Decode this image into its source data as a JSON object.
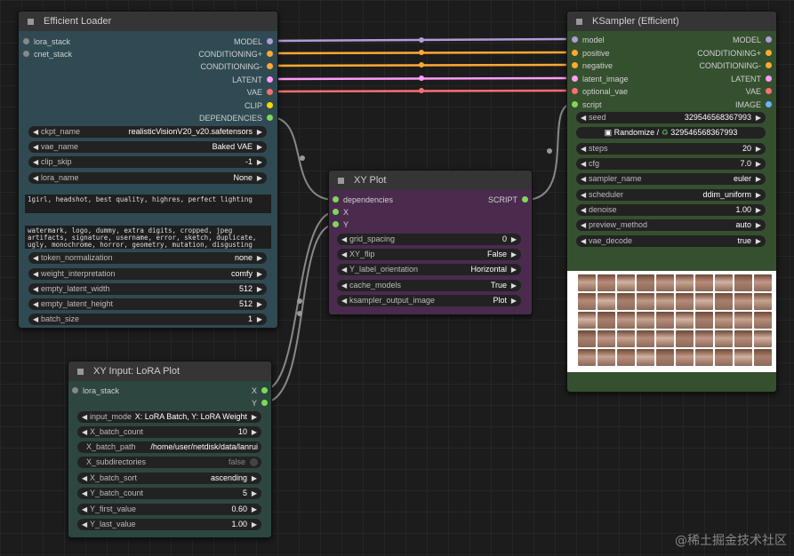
{
  "colors": {
    "model": "#b19cd9",
    "conditioning": "#ffa931",
    "latent": "#ff9cf9",
    "vae": "#ff6e6e",
    "clip": "#ffd500",
    "dependencies": "#7ed957",
    "script": "#7ed957",
    "image": "#64b5f6",
    "loader_bg": "#2f4a52",
    "ksampler_bg": "#35502f",
    "xyplot_bg": "#4a2b4e",
    "xyinput_bg": "#2d4640"
  },
  "efficient_loader": {
    "title": "Efficient Loader",
    "inputs": [
      "lora_stack",
      "cnet_stack"
    ],
    "outputs": [
      "MODEL",
      "CONDITIONING+",
      "CONDITIONING-",
      "LATENT",
      "VAE",
      "CLIP",
      "DEPENDENCIES"
    ],
    "widgets": [
      {
        "label": "ckpt_name",
        "value": "realisticVisionV20_v20.safetensors"
      },
      {
        "label": "vae_name",
        "value": "Baked VAE"
      },
      {
        "label": "clip_skip",
        "value": "-1"
      },
      {
        "label": "lora_name",
        "value": "None"
      }
    ],
    "positive_prompt": "1girl, headshot, best quality, highres, perfect lighting",
    "negative_prompt": "watermark, logo, dummy, extra digits, cropped, jpeg artifacts, signature, username, error, sketch, duplicate, ugly, monochrome, horror, geometry, mutation, disgusting",
    "widgets2": [
      {
        "label": "token_normalization",
        "value": "none"
      },
      {
        "label": "weight_interpretation",
        "value": "comfy"
      },
      {
        "label": "empty_latent_width",
        "value": "512"
      },
      {
        "label": "empty_latent_height",
        "value": "512"
      },
      {
        "label": "batch_size",
        "value": "1"
      }
    ]
  },
  "ksampler": {
    "title": "KSampler (Efficient)",
    "inputs": [
      "model",
      "positive",
      "negative",
      "latent_image",
      "optional_vae",
      "script"
    ],
    "outputs": [
      "MODEL",
      "CONDITIONING+",
      "CONDITIONING-",
      "LATENT",
      "VAE",
      "IMAGE"
    ],
    "seed": {
      "label": "seed",
      "value": "329546568367993"
    },
    "randomize_label": "Randomize / ",
    "randomize_value": "329546568367993",
    "widgets": [
      {
        "label": "steps",
        "value": "20"
      },
      {
        "label": "cfg",
        "value": "7.0"
      },
      {
        "label": "sampler_name",
        "value": "euler"
      },
      {
        "label": "scheduler",
        "value": "ddim_uniform"
      },
      {
        "label": "denoise",
        "value": "1.00"
      },
      {
        "label": "preview_method",
        "value": "auto"
      },
      {
        "label": "vae_decode",
        "value": "true"
      }
    ]
  },
  "xy_plot": {
    "title": "XY Plot",
    "inputs": [
      "dependencies",
      "X",
      "Y"
    ],
    "output": "SCRIPT",
    "widgets": [
      {
        "label": "grid_spacing",
        "value": "0"
      },
      {
        "label": "XY_flip",
        "value": "False"
      },
      {
        "label": "Y_label_orientation",
        "value": "Horizontal"
      },
      {
        "label": "cache_models",
        "value": "True"
      },
      {
        "label": "ksampler_output_image",
        "value": "Plot"
      }
    ]
  },
  "xy_input": {
    "title": "XY Input: LoRA Plot",
    "input": "lora_stack",
    "outputs": [
      "X",
      "Y"
    ],
    "widgets": [
      {
        "label": "input_mode",
        "value": "X: LoRA Batch, Y: LoRA Weight"
      },
      {
        "label": "X_batch_count",
        "value": "10"
      },
      {
        "label": "X_batch_path",
        "value": "/home/user/netdisk/data/lanrui"
      },
      {
        "label": "X_subdirectories",
        "value": "false"
      },
      {
        "label": "X_batch_sort",
        "value": "ascending"
      },
      {
        "label": "Y_batch_count",
        "value": "5"
      },
      {
        "label": "Y_first_value",
        "value": "0.60"
      },
      {
        "label": "Y_last_value",
        "value": "1.00"
      }
    ]
  },
  "watermark": "@稀土掘金技术社区"
}
